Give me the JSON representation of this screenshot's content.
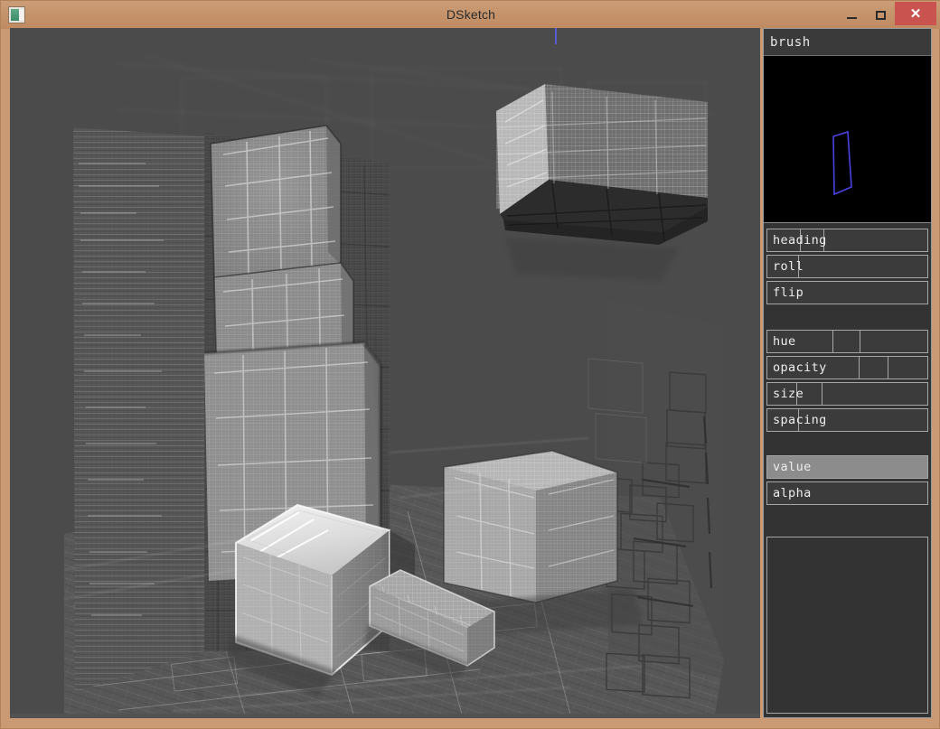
{
  "window": {
    "title": "DSketch",
    "icon": "app-icon",
    "controls": {
      "minimize": "–",
      "maximize": "□",
      "close": "✕"
    },
    "frame_color": "#c99a74",
    "titlebar_color": "#c4926a",
    "close_button_color": "#c9534f"
  },
  "canvas": {
    "name": "drawing-canvas",
    "background_color": "#4b4b4b",
    "artwork_description": "Grayscale cross-hatched pencil sketch of stacked cardboard boxes in a corner room: a tall stacked column of boxes at left against a hatched wall, a floating box with a dark underside at upper right, a bright white-topped cube in the foreground, a small elongated box beside it, a mid-size box at right, wireframe rectangle outlines sketched on the right wall, and a hatched tiled floor.",
    "cursor_marker_color": "#5b5bd6"
  },
  "panel": {
    "name": "brush-panel",
    "header": "brush",
    "preview": {
      "name": "brush-nib-preview",
      "background_color": "#000000",
      "shape": "trapezoid-outline",
      "stroke_color": "#4a42e0"
    },
    "transform_rows": [
      {
        "label": "heading",
        "ticks": [
          36,
          62
        ]
      },
      {
        "label": "roll",
        "ticks": [
          34
        ]
      },
      {
        "label": "flip",
        "ticks": []
      }
    ],
    "brush_rows": [
      {
        "label": "hue",
        "ticks": [
          72,
          102
        ]
      },
      {
        "label": "opacity",
        "ticks": [
          101,
          133
        ]
      },
      {
        "label": "size",
        "ticks": [
          32,
          60
        ]
      },
      {
        "label": "spacing",
        "ticks": [
          34
        ]
      }
    ],
    "color_rows": [
      {
        "label": "value",
        "active": true,
        "ticks": []
      },
      {
        "label": "alpha",
        "active": false,
        "ticks": []
      }
    ],
    "active_row_color": "#8c8c8c",
    "row_background_color": "#3b3b3b",
    "row_border_color": "#a6a6a6"
  }
}
